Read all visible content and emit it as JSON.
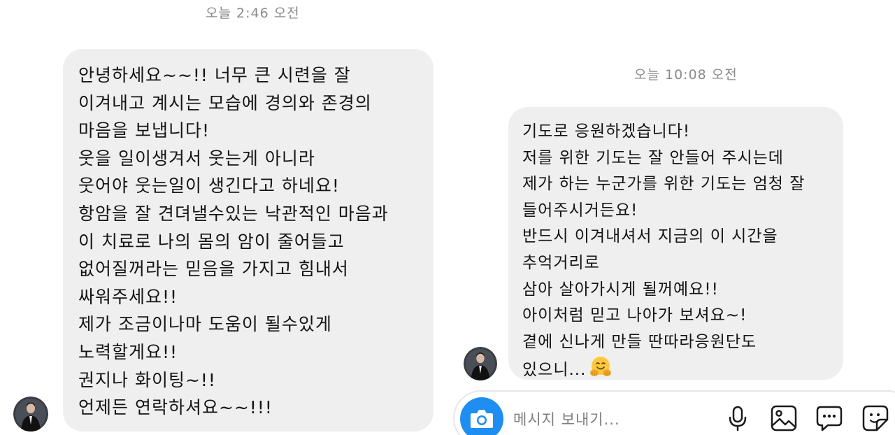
{
  "timestamps": {
    "first": "오늘 2:46 오전",
    "second": "오늘 10:08 오전"
  },
  "message_left": {
    "lines": [
      "안녕하세요~~!! 너무 큰 시련을 잘",
      "이겨내고 계시는 모습에 경의와 존경의",
      "마음을 보냅니다!",
      "웃을 일이생겨서 웃는게 아니라",
      "웃어야 웃는일이 생긴다고 하네요!",
      "항암을 잘 견뎌낼수있는 낙관적인 마음과",
      "이 치료로 나의 몸의 암이 줄어들고",
      "없어질꺼라는 믿음을 가지고 힘내서",
      "싸워주세요!!",
      "제가 조금이나마 도움이 될수있게",
      "노력할게요!!",
      "권지나 화이팅~!!",
      "언제든 연락하셔요~~!!!"
    ]
  },
  "message_right": {
    "lines": [
      "기도로 응원하겠습니다!",
      "저를 위한 기도는 잘 안들어 주시는데",
      "제가 하는 누군가를 위한 기도는 엄청 잘",
      "들어주시거든요!",
      "반드시 이겨내셔서 지금의 이 시간을",
      "추억거리로",
      "삼아 살아가시게 될꺼예요!!",
      "아이처럼 믿고 나아가 보셔요~!",
      "곁에 신나게 만들 딴따라응원단도",
      "있으니..."
    ],
    "emoji": "hugging-face-emoji"
  },
  "composer": {
    "placeholder": "메시지 보내기...",
    "accent_color": "#1f8ef1",
    "icons": [
      "camera-icon",
      "microphone-icon",
      "image-icon",
      "chat-bubble-icon",
      "sticker-icon"
    ]
  },
  "colors": {
    "bubble": "#efeff0",
    "text": "#141414",
    "timestamp": "#8a8a8a"
  }
}
